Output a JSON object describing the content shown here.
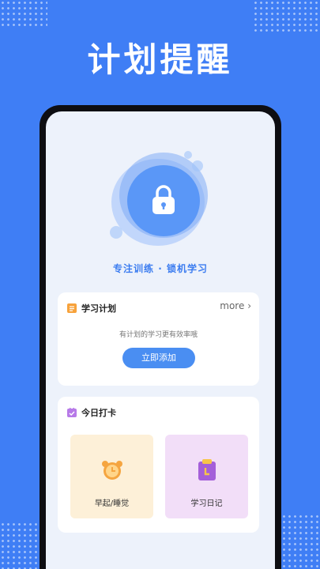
{
  "headline": "计划提醒",
  "focus_caption": "专注训练 · 锁机学习",
  "plan_card": {
    "title": "学习计划",
    "more": "more",
    "subtitle": "有计划的学习更有效率哦",
    "button": "立即添加"
  },
  "checkin_card": {
    "title": "今日打卡",
    "tiles": [
      {
        "label": "早起/睡觉",
        "icon": "alarm-clock-icon"
      },
      {
        "label": "学习日记",
        "icon": "diary-icon"
      }
    ]
  },
  "nav_icons": [
    "home-icon",
    "book-icon",
    "calendar-icon",
    "profile-icon"
  ],
  "colors": {
    "brand": "#3f7ef5",
    "accent": "#4a8ef2",
    "wake_tile": "#fdf0d8",
    "diary_tile": "#f2def8"
  }
}
